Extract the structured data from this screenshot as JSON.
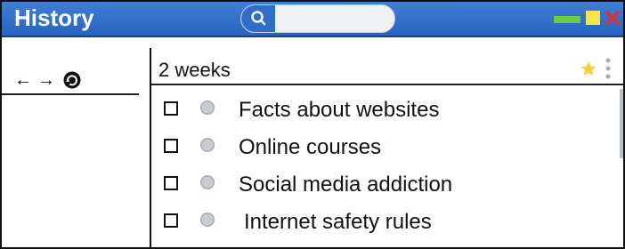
{
  "window": {
    "title": "History"
  },
  "search": {
    "placeholder": "",
    "icon": "search-icon"
  },
  "window_controls": {
    "icons": [
      "minimize-icon",
      "maximize-icon",
      "close-icon"
    ]
  },
  "navigation": {
    "icons": [
      "back-arrow-icon",
      "forward-arrow-icon",
      "refresh-icon"
    ]
  },
  "history": {
    "period_label": "2 weeks",
    "items": [
      {
        "label": "Facts about websites"
      },
      {
        "label": "Online courses"
      },
      {
        "label": "Social media addiction"
      },
      {
        "label": "Internet safety rules"
      }
    ]
  },
  "colors": {
    "titlebar": "#2f6dcb",
    "star": "#f6d23a",
    "minimize": "#70c94a",
    "maximize": "#f7e34e",
    "close": "#d8333c"
  }
}
